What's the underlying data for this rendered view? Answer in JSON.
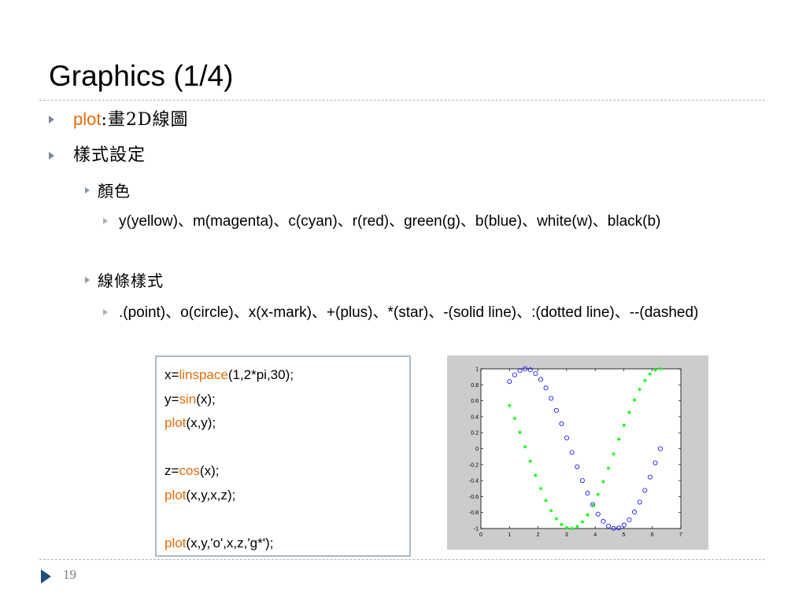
{
  "slide": {
    "title": "Graphics (1/4)",
    "page_number": "19"
  },
  "bullets": {
    "plot_keyword": "plot",
    "plot_desc": ":畫2D線圖",
    "style_settings": "樣式設定",
    "color_heading": "顏色",
    "color_list": "y(yellow)、m(magenta)、c(cyan)、r(red)、green(g)、b(blue)、white(w)、black(b)",
    "line_style_heading": "線條樣式",
    "line_style_list": ".(point)、o(circle)、x(x-mark)、+(plus)、*(star)、-(solid line)、:(dotted line)、--(dashed)"
  },
  "code": {
    "lines": [
      {
        "pre": "x=",
        "fn": "linspace",
        "post": "(1,2*pi,30);"
      },
      {
        "pre": "y=",
        "fn": "sin",
        "post": "(x);"
      },
      {
        "pre": "",
        "fn": "plot",
        "post": "(x,y);"
      },
      {
        "pre": "",
        "fn": "",
        "post": ""
      },
      {
        "pre": "z=",
        "fn": "cos",
        "post": "(x);"
      },
      {
        "pre": "",
        "fn": "plot",
        "post": "(x,y,x,z);"
      },
      {
        "pre": "",
        "fn": "",
        "post": ""
      },
      {
        "pre": "",
        "fn": "plot",
        "post": "(x,y,'o',x,z,'g*');"
      }
    ]
  },
  "colors": {
    "keyword": "#e36c0a",
    "sin_series": "#0000ff",
    "cos_series": "#00ff00",
    "chart_background": "#cccccc",
    "code_border": "#a6bccd"
  },
  "chart_data": {
    "type": "scatter",
    "title": "",
    "xlabel": "",
    "ylabel": "",
    "xlim": [
      0,
      7
    ],
    "ylim": [
      -1,
      1
    ],
    "xticks": [
      "0",
      "1",
      "2",
      "3",
      "4",
      "5",
      "6",
      "7"
    ],
    "yticks": [
      "-1",
      "-0.8",
      "-0.6",
      "-0.4",
      "-0.2",
      "0",
      "0.2",
      "0.4",
      "0.6",
      "0.8",
      "1"
    ],
    "grid": false,
    "x": [
      1,
      1.1823,
      1.3646,
      1.547,
      1.7293,
      1.9116,
      2.0939,
      2.2762,
      2.4585,
      2.6409,
      2.8232,
      3.0055,
      3.1878,
      3.3701,
      3.5524,
      3.7348,
      3.9171,
      4.0994,
      4.2817,
      4.464,
      4.6463,
      4.8287,
      5.011,
      5.1933,
      5.3756,
      5.5579,
      5.7402,
      5.9226,
      6.1049,
      6.2832
    ],
    "series": [
      {
        "marker": "o",
        "color": "#0000ff",
        "values": [
          0.8415,
          0.9252,
          0.9788,
          0.9998,
          0.9874,
          0.9425,
          0.8669,
          0.7606,
          0.6305,
          0.4787,
          0.3128,
          0.1356,
          -0.0462,
          -0.2262,
          -0.3986,
          -0.5583,
          -0.7013,
          -0.8198,
          -0.9105,
          -0.9692,
          -0.9978,
          -0.9929,
          -0.9572,
          -0.8905,
          -0.7934,
          -0.6697,
          -0.5217,
          -0.3558,
          -0.1774,
          0.0
        ]
      },
      {
        "marker": "*",
        "color": "#00ff00",
        "values": [
          0.5403,
          0.3796,
          0.205,
          0.0238,
          -0.158,
          -0.3342,
          -0.4985,
          -0.6493,
          -0.7762,
          -0.878,
          -0.9499,
          -0.9908,
          -0.9989,
          -0.9741,
          -0.9171,
          -0.8296,
          -0.7128,
          -0.5727,
          -0.4135,
          -0.2463,
          -0.0665,
          0.1187,
          0.294,
          0.4552,
          0.6089,
          0.7427,
          0.8531,
          0.9346,
          0.9842,
          1.0
        ]
      }
    ]
  }
}
